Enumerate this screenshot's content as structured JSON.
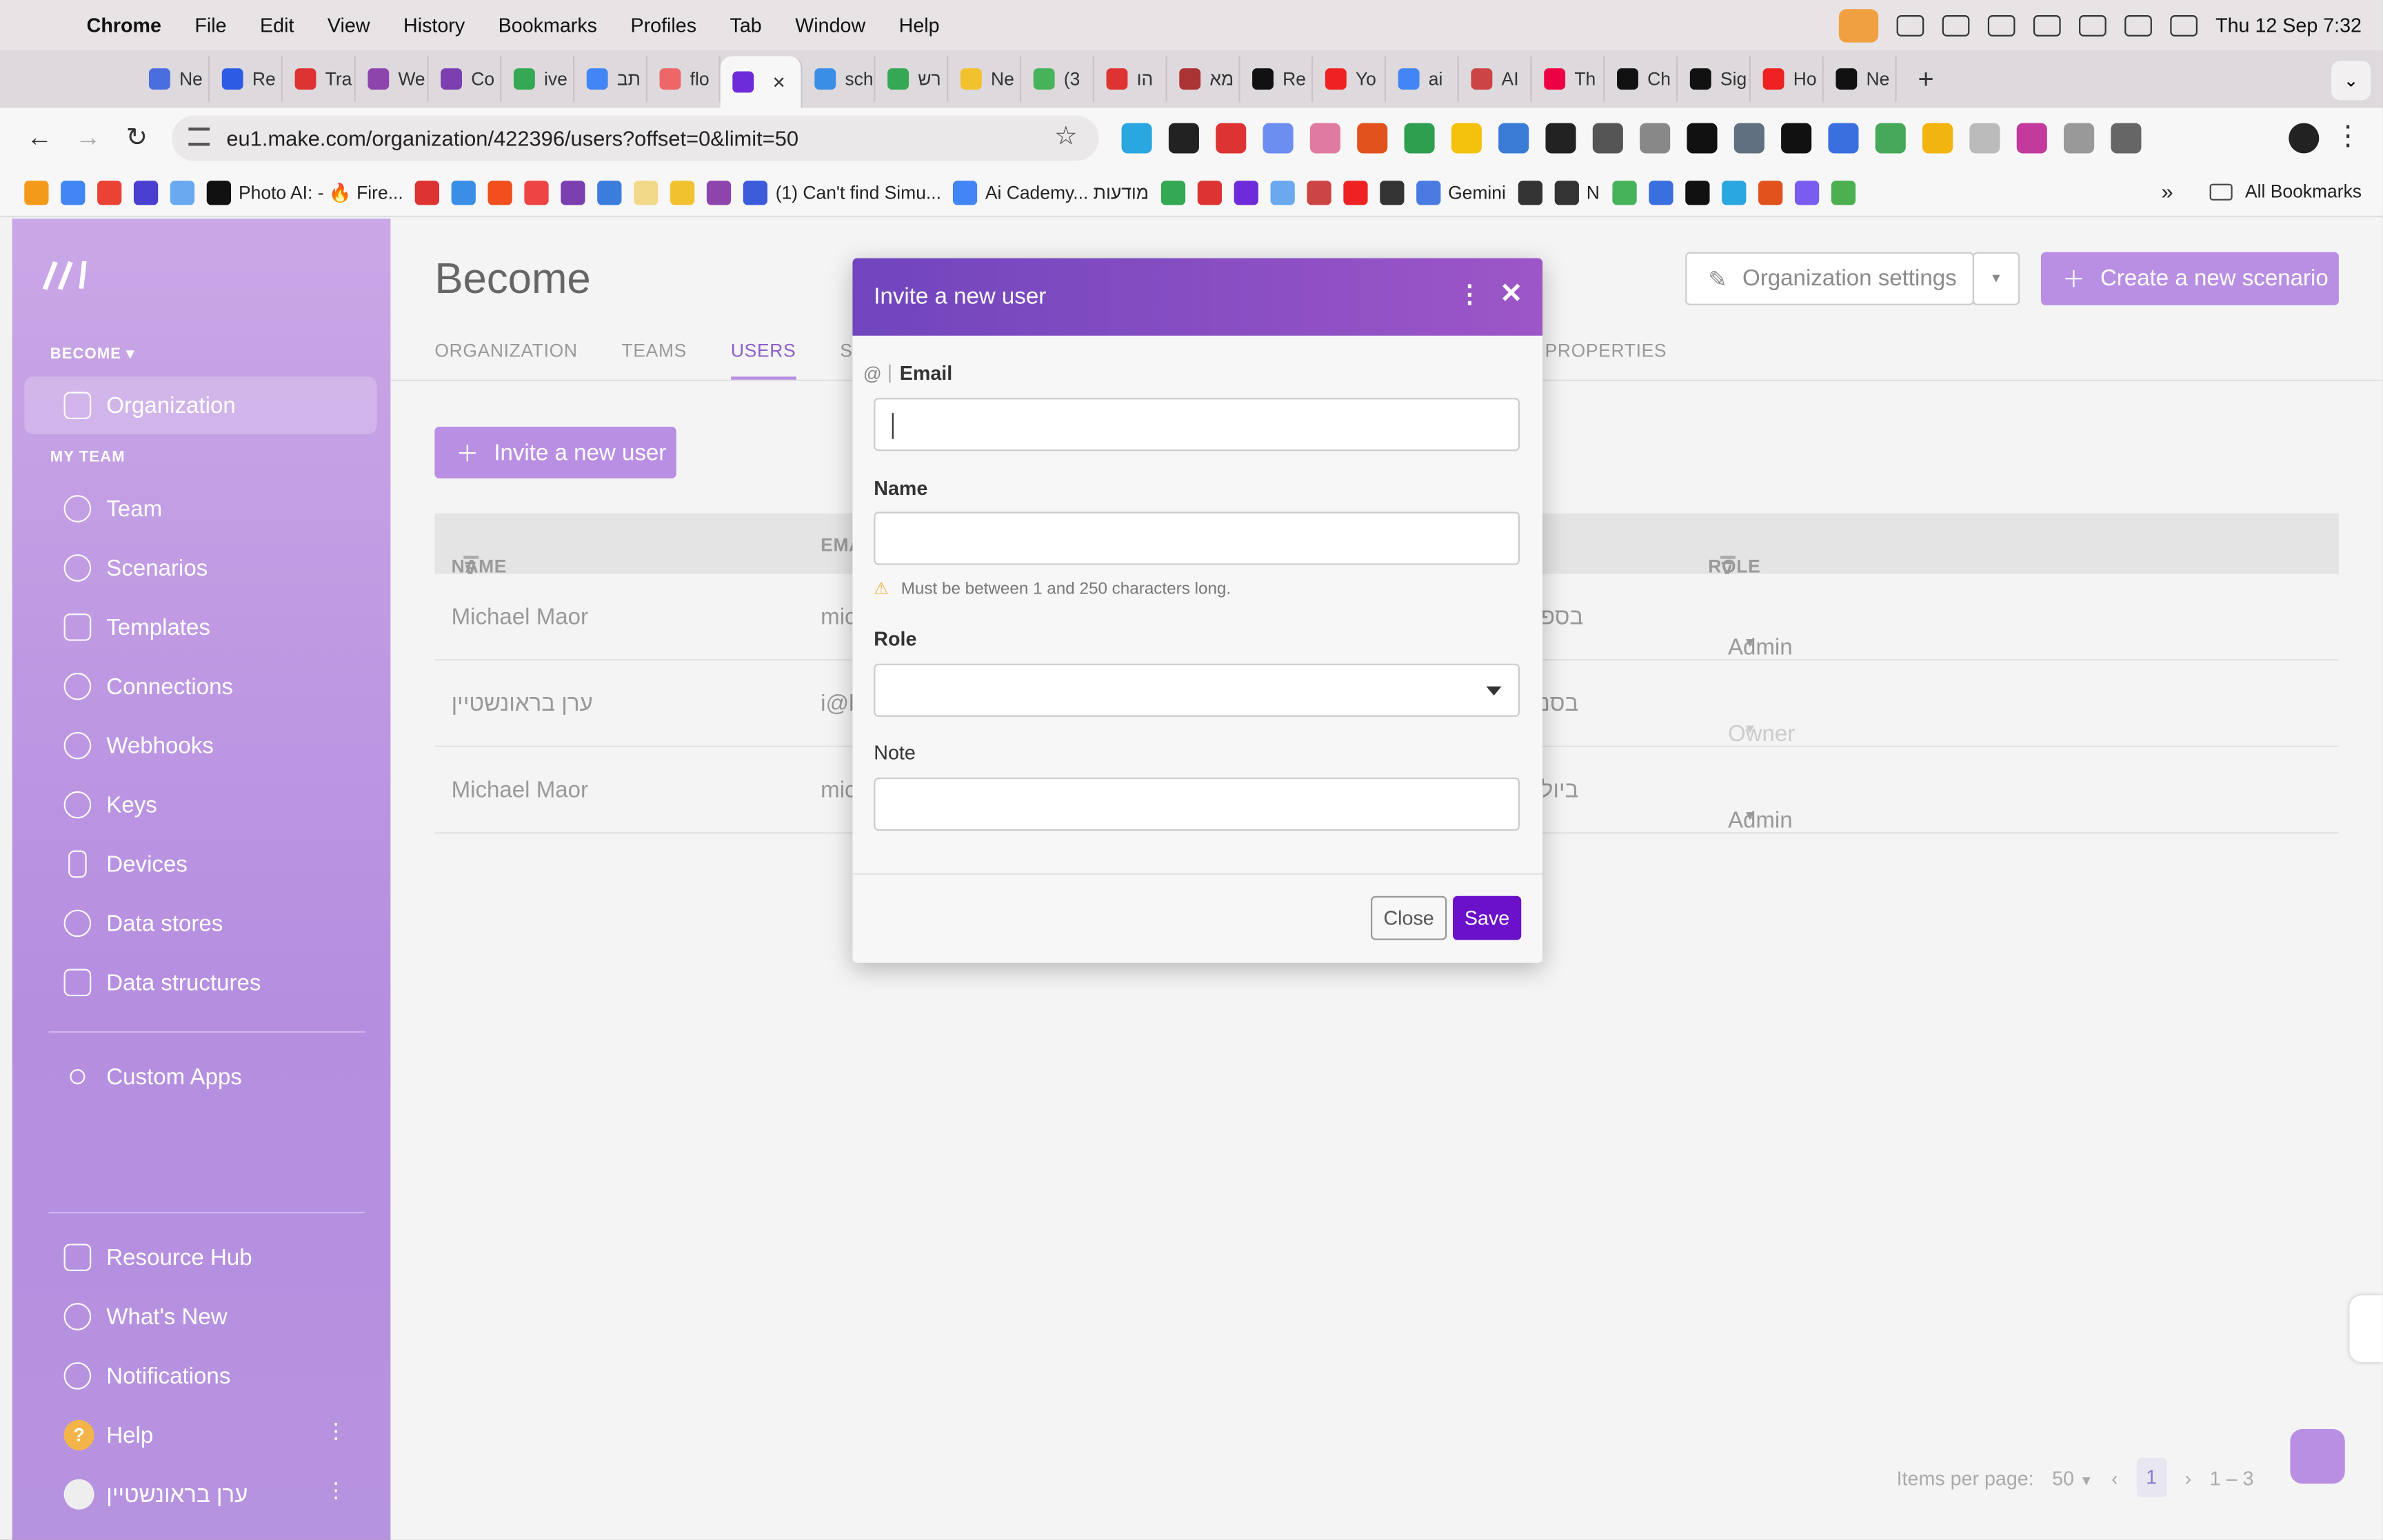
{
  "menubar": {
    "app": "Chrome",
    "items": [
      "File",
      "Edit",
      "View",
      "History",
      "Bookmarks",
      "Profiles",
      "Tab",
      "Window",
      "Help"
    ],
    "clock": "Thu 12 Sep  7:32"
  },
  "tabs": [
    {
      "label": "Ne",
      "color": "#4a6ee0"
    },
    {
      "label": "Re",
      "color": "#2d5be3"
    },
    {
      "label": "Tra",
      "color": "#d33"
    },
    {
      "label": "We",
      "color": "#8e44ad"
    },
    {
      "label": "Co",
      "color": "#7b3fb0"
    },
    {
      "label": "ive",
      "color": "#34a853"
    },
    {
      "label": "תב",
      "color": "#4285f4"
    },
    {
      "label": "flo",
      "color": "#e66"
    },
    {
      "label": "",
      "color": "#6d2bd9",
      "active": true
    },
    {
      "label": "sch",
      "color": "#3a8ee6"
    },
    {
      "label": "רש",
      "color": "#34a853"
    },
    {
      "label": "Ne",
      "color": "#f2c12e"
    },
    {
      "label": "(3",
      "color": "#46b35a"
    },
    {
      "label": "הו",
      "color": "#d33"
    },
    {
      "label": "מא",
      "color": "#a33"
    },
    {
      "label": "Re",
      "color": "#111"
    },
    {
      "label": "Yo",
      "color": "#e22"
    },
    {
      "label": "ai",
      "color": "#4285f4"
    },
    {
      "label": "AI",
      "color": "#c44"
    },
    {
      "label": "Th",
      "color": "#e04"
    },
    {
      "label": "Ch",
      "color": "#111"
    },
    {
      "label": "Sig",
      "color": "#111"
    },
    {
      "label": "Ho",
      "color": "#e22"
    },
    {
      "label": "Ne",
      "color": "#111"
    }
  ],
  "omnibox": {
    "url": "eu1.make.com/organization/422396/users?offset=0&limit=50"
  },
  "bookmarks": {
    "items": [
      "Photo AI: - 🔥 Fire...",
      "(1) Can't find Simu...",
      "Ai Cademy... מודעות",
      "Gemini",
      "N"
    ],
    "all_label": "All Bookmarks"
  },
  "sidebar": {
    "org_switch": "BECOME ▾",
    "organization": "Organization",
    "section_my_team": "MY TEAM",
    "items": [
      "Team",
      "Scenarios",
      "Templates",
      "Connections",
      "Webhooks",
      "Keys",
      "Devices",
      "Data stores",
      "Data structures"
    ],
    "custom_apps": "Custom Apps",
    "bottom": [
      "Resource Hub",
      "What's New",
      "Notifications",
      "Help"
    ],
    "user_name": "ערן בראונשטיין"
  },
  "main": {
    "title": "Become",
    "org_settings": "Organization settings",
    "create_scenario": "Create a new scenario",
    "tabs": [
      "ORGANIZATION",
      "TEAMS",
      "USERS",
      "SUB"
    ],
    "tab_tail": "D PROPERTIES",
    "invite_button": "Invite a new user",
    "table": {
      "headers": {
        "name": "NAME",
        "email": "EMA",
        "role": "ROLE"
      },
      "rows": [
        {
          "name": "Michael Maor",
          "email": "mic",
          "team": "בספ",
          "role": "Admin"
        },
        {
          "name": "ערן בראונשטיין",
          "email": "i@b",
          "team": "בסנ",
          "role": "Owner"
        },
        {
          "name": "Michael Maor",
          "email": "mic",
          "team": "ביול",
          "role": "Admin"
        }
      ]
    },
    "pager": {
      "label": "Items per page:",
      "per_page": "50",
      "page": "1",
      "range": "1 – 3"
    }
  },
  "modal": {
    "title": "Invite a new user",
    "email_label": "Email",
    "email_value": "",
    "name_label": "Name",
    "name_value": "",
    "name_hint": "Must be between 1 and 250 characters long.",
    "role_label": "Role",
    "role_value": "",
    "note_label": "Note",
    "note_value": "",
    "close": "Close",
    "save": "Save"
  },
  "colors": {
    "accent": "#b98fe3",
    "save": "#6b11c9",
    "modal_header_start": "#7045bd",
    "modal_header_end": "#9d56c7"
  }
}
